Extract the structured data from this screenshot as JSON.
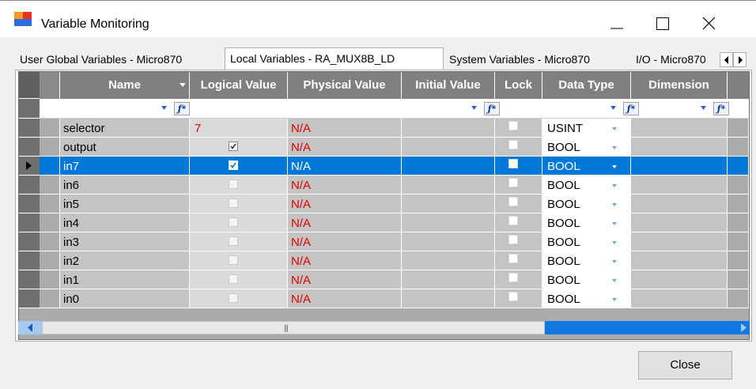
{
  "window": {
    "title": "Variable Monitoring",
    "icon": "variable-monitoring-app-icon"
  },
  "tabs": [
    {
      "label": "User Global Variables - Micro870",
      "active": false
    },
    {
      "label": "Local Variables - RA_MUX8B_LD",
      "active": true
    },
    {
      "label": "System Variables - Micro870",
      "active": false
    },
    {
      "label": "I/O - Micro870",
      "active": false
    }
  ],
  "grid": {
    "columns": [
      {
        "label": "Name",
        "sort_icon": "sort-dropdown-icon"
      },
      {
        "label": "Logical Value"
      },
      {
        "label": "Physical Value"
      },
      {
        "label": "Initial Value"
      },
      {
        "label": "Lock"
      },
      {
        "label": "Data Type"
      },
      {
        "label": "Dimension"
      }
    ],
    "filter_icon": "filter-icon",
    "rows": [
      {
        "name": "selector",
        "logical_value": "7",
        "logical_kind": "text",
        "physical_value": "N/A",
        "initial_value": "",
        "lock": false,
        "data_type": "USINT",
        "dimension": "",
        "selected": false
      },
      {
        "name": "output",
        "logical_value": "",
        "logical_kind": "checkbox",
        "checked": true,
        "physical_value": "N/A",
        "initial_value": "",
        "lock": false,
        "data_type": "BOOL",
        "dimension": "",
        "selected": false
      },
      {
        "name": "in7",
        "logical_value": "",
        "logical_kind": "checkbox",
        "checked": true,
        "physical_value": "N/A",
        "initial_value": "",
        "lock": false,
        "data_type": "BOOL",
        "dimension": "",
        "selected": true
      },
      {
        "name": "in6",
        "logical_value": "",
        "logical_kind": "checkbox",
        "checked": false,
        "physical_value": "N/A",
        "initial_value": "",
        "lock": false,
        "data_type": "BOOL",
        "dimension": "",
        "selected": false
      },
      {
        "name": "in5",
        "logical_value": "",
        "logical_kind": "checkbox",
        "checked": false,
        "physical_value": "N/A",
        "initial_value": "",
        "lock": false,
        "data_type": "BOOL",
        "dimension": "",
        "selected": false
      },
      {
        "name": "in4",
        "logical_value": "",
        "logical_kind": "checkbox",
        "checked": false,
        "physical_value": "N/A",
        "initial_value": "",
        "lock": false,
        "data_type": "BOOL",
        "dimension": "",
        "selected": false
      },
      {
        "name": "in3",
        "logical_value": "",
        "logical_kind": "checkbox",
        "checked": false,
        "physical_value": "N/A",
        "initial_value": "",
        "lock": false,
        "data_type": "BOOL",
        "dimension": "",
        "selected": false
      },
      {
        "name": "in2",
        "logical_value": "",
        "logical_kind": "checkbox",
        "checked": false,
        "physical_value": "N/A",
        "initial_value": "",
        "lock": false,
        "data_type": "BOOL",
        "dimension": "",
        "selected": false
      },
      {
        "name": "in1",
        "logical_value": "",
        "logical_kind": "checkbox",
        "checked": false,
        "physical_value": "N/A",
        "initial_value": "",
        "lock": false,
        "data_type": "BOOL",
        "dimension": "",
        "selected": false
      },
      {
        "name": "in0",
        "logical_value": "",
        "logical_kind": "checkbox",
        "checked": false,
        "physical_value": "N/A",
        "initial_value": "",
        "lock": false,
        "data_type": "BOOL",
        "dimension": "",
        "selected": false
      }
    ]
  },
  "buttons": {
    "close_label": "Close"
  },
  "colors": {
    "selection": "#0078d7",
    "error_text": "#e00000",
    "header_bg": "#808080"
  }
}
